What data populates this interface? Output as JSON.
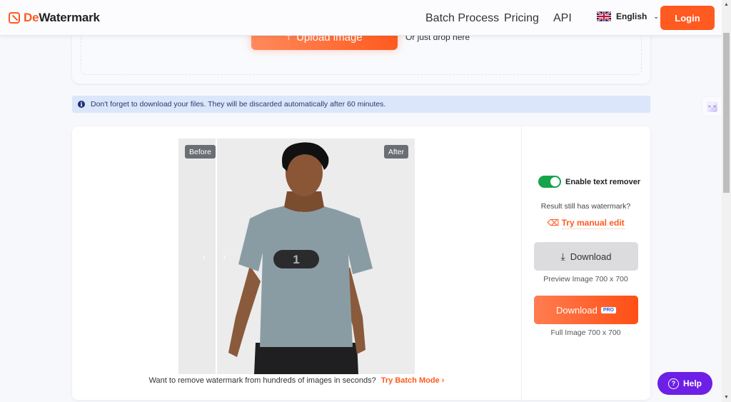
{
  "header": {
    "brand_prefix": "De",
    "brand_suffix": "Watermark",
    "nav": [
      "Batch Process",
      "Pricing",
      "API"
    ],
    "language": "English",
    "login_label": "Login"
  },
  "upload": {
    "button_label": "Upload image",
    "drop_text": "Or just drop here"
  },
  "notice": {
    "text": "Don't forget to download your files. They will be discarded automatically after 60 minutes."
  },
  "preview": {
    "before_label": "Before",
    "after_label": "After",
    "shirt_number": "1",
    "arrow_left": "‹",
    "arrow_right": "›",
    "bottom_text": "Want to remove watermark from hundreds of images in seconds?",
    "batch_link": "Try Batch Mode",
    "batch_chevron": "›"
  },
  "panel": {
    "toggle_label": "Enable text remover",
    "toggle_on": true,
    "still_text": "Result still has watermark?",
    "manual_edit": "Try manual edit",
    "download_preview_label": "Download",
    "preview_caption": "Preview Image 700 x 700",
    "download_full_label": "Download",
    "pro_badge": "PRO",
    "full_caption": "Full Image 700 x 700"
  },
  "help": {
    "label": "Help"
  },
  "colors": {
    "accent": "#ff5a1f",
    "toggle_on": "#16a34a",
    "help": "#6d1fe6",
    "notice_bg": "#dbe6fb"
  }
}
